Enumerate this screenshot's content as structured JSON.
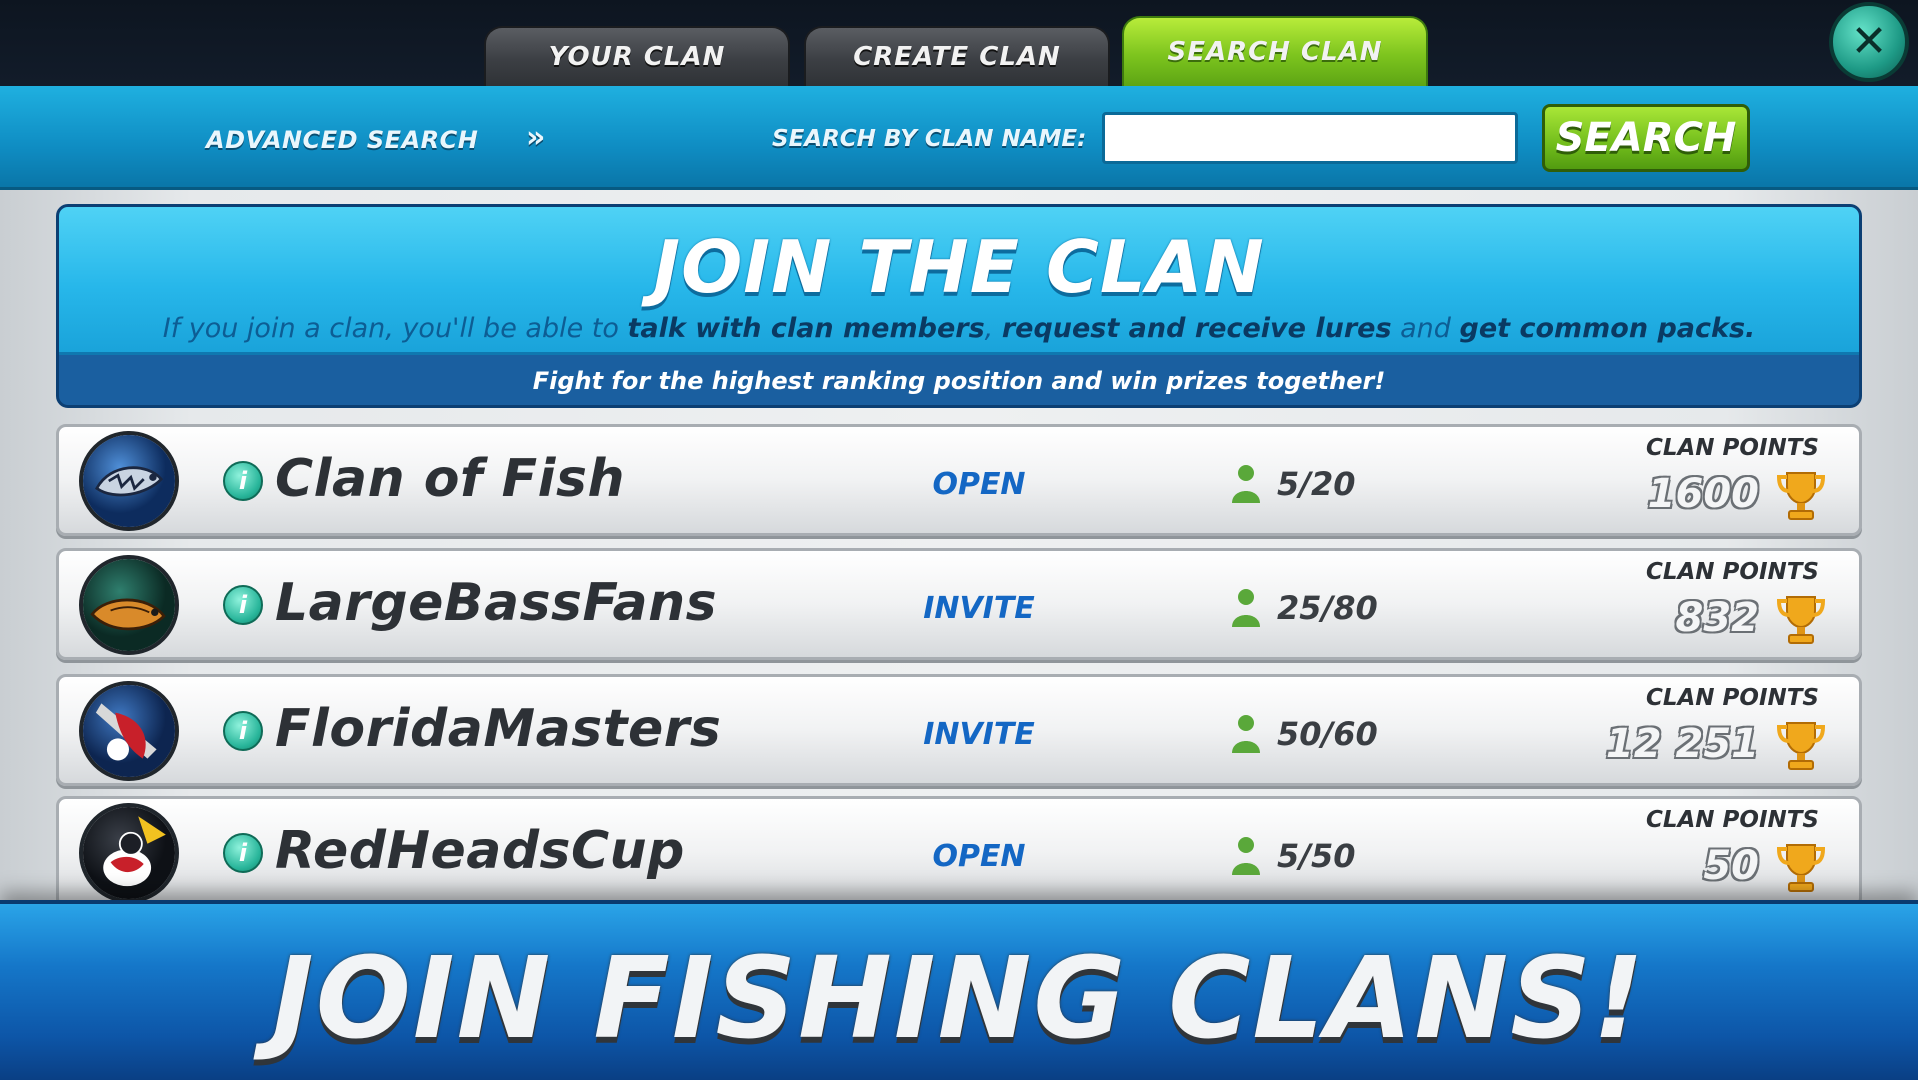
{
  "tabs": [
    {
      "label": "YOUR CLAN",
      "active": false
    },
    {
      "label": "CREATE CLAN",
      "active": false
    },
    {
      "label": "SEARCH CLAN",
      "active": true
    }
  ],
  "close_icon": "close-icon",
  "search": {
    "advanced_label": "ADVANCED SEARCH",
    "advanced_arrow": "»",
    "name_label": "SEARCH BY CLAN NAME:",
    "input_value": "",
    "button_label": "SEARCH"
  },
  "join": {
    "title": "JOIN THE CLAN",
    "desc_1": "If you join a clan, you'll be able to ",
    "desc_2": "talk with clan members",
    "desc_3": ", ",
    "desc_4": "request and receive lures",
    "desc_5": " and ",
    "desc_6": "get common packs.",
    "subtitle": "Fight for the highest ranking position and win prizes together!"
  },
  "clans": [
    {
      "name": "Clan of Fish",
      "status": "OPEN",
      "members": "5/20",
      "points_label": "CLAN POINTS",
      "points": "1600"
    },
    {
      "name": "LargeBassFans",
      "status": "INVITE",
      "members": "25/80",
      "points_label": "CLAN POINTS",
      "points": "832"
    },
    {
      "name": "FloridaMasters",
      "status": "INVITE",
      "members": "50/60",
      "points_label": "CLAN POINTS",
      "points": "12 251"
    },
    {
      "name": "RedHeadsCup",
      "status": "OPEN",
      "members": "5/50",
      "points_label": "CLAN POINTS",
      "points": "50"
    }
  ],
  "info_glyph": "i",
  "banner": {
    "title": "JOIN FISHING CLANS!"
  },
  "colors": {
    "active_tab": "#7dc41e",
    "search_bar": "#0f8dc3",
    "status_text": "#1467c4",
    "banner_blue": "#1577c9"
  }
}
